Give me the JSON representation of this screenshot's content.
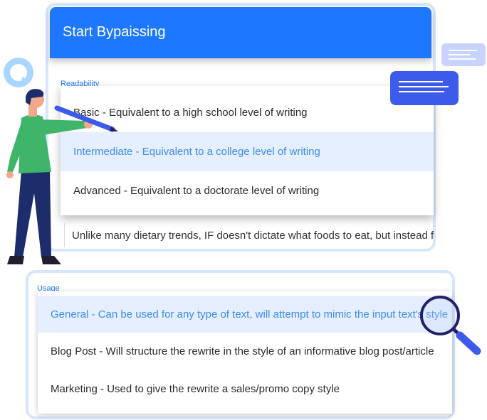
{
  "header": {
    "title": "Start Bypaissing"
  },
  "readability": {
    "label": "Readability",
    "options": [
      "Basic - Equivalent to a high school level of writing",
      "Intermediate - Equivalent to a college level of writing",
      "Advanced - Equivalent to a doctorate level of writing"
    ],
    "selected_index": 1
  },
  "preview_text": "Unlike many dietary trends, IF doesn't dictate what foods to eat, but instead focuses on when to eat",
  "usage": {
    "label": "Usage",
    "options": [
      "General - Can be used for any type of text, will attempt to mimic the input text's style",
      "Blog Post - Will structure the rewrite in the style of an informative blog post/article",
      "Marketing - Used to give the rewrite a sales/promo copy style"
    ],
    "selected_index": 0
  },
  "colors": {
    "accent": "#1e78ff",
    "selected_text": "#3a8df2",
    "selected_bg": "#e6efff",
    "card_border": "#d7e6ff"
  },
  "icons": [
    "chat-bubble-icon",
    "text-card-icon",
    "magnifier-icon",
    "pencil-icon",
    "person-illustration"
  ]
}
